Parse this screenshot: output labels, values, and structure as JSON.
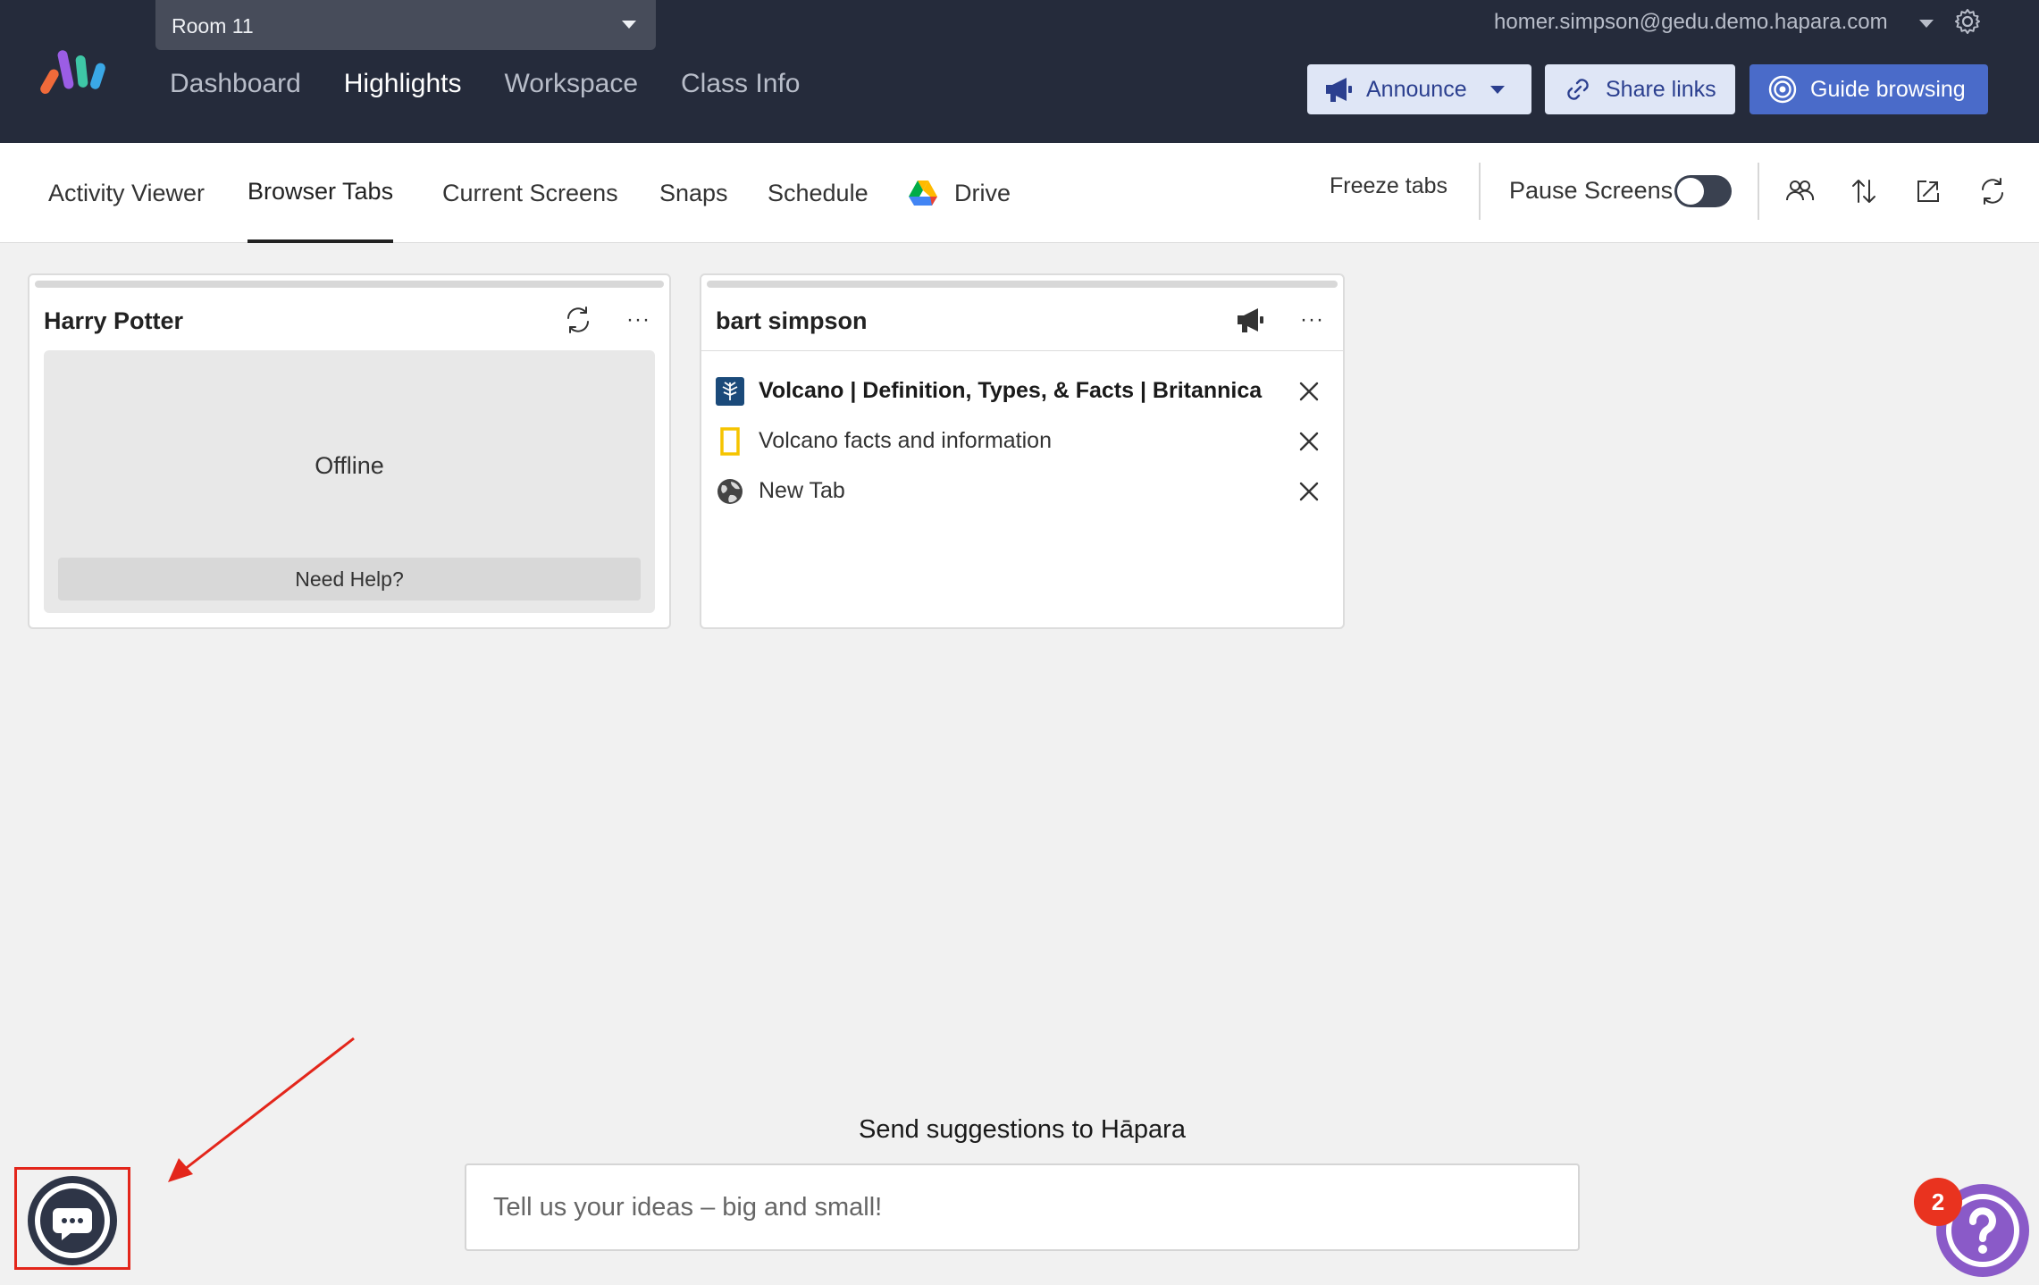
{
  "header": {
    "class_selector": "Room 11",
    "nav": [
      "Dashboard",
      "Highlights",
      "Workspace",
      "Class Info"
    ],
    "active_nav": "Highlights",
    "user_email": "homer.simpson@gedu.demo.hapara.com",
    "buttons": {
      "announce": "Announce",
      "share_links": "Share links",
      "guide_browsing": "Guide browsing"
    }
  },
  "subnav": {
    "tabs": [
      "Activity Viewer",
      "Browser Tabs",
      "Current Screens",
      "Snaps",
      "Schedule",
      "Drive"
    ],
    "active_tab": "Browser Tabs",
    "freeze_tabs": "Freeze tabs",
    "pause_screens": "Pause Screens",
    "pause_screens_on": false
  },
  "students": [
    {
      "name": "Harry Potter",
      "status": "Offline",
      "help_label": "Need Help?"
    },
    {
      "name": "bart simpson",
      "tabs": [
        {
          "title": "Volcano | Definition, Types, & Facts | Britannica",
          "icon": "britannica-icon",
          "active": true
        },
        {
          "title": "Volcano facts and information",
          "icon": "natgeo-icon",
          "active": false
        },
        {
          "title": "New Tab",
          "icon": "globe-icon",
          "active": false
        }
      ]
    }
  ],
  "suggestions": {
    "title": "Send suggestions to Hāpara",
    "placeholder": "Tell us your ideas – big and small!"
  },
  "help": {
    "badge_count": "2"
  },
  "colors": {
    "topbar": "#252b3b",
    "primary_button": "#4a6bc9",
    "secondary_button": "#dfe6f6",
    "highlight_outline": "#e3261b",
    "help_fab": "#8a5ac8",
    "badge": "#e9331f"
  }
}
